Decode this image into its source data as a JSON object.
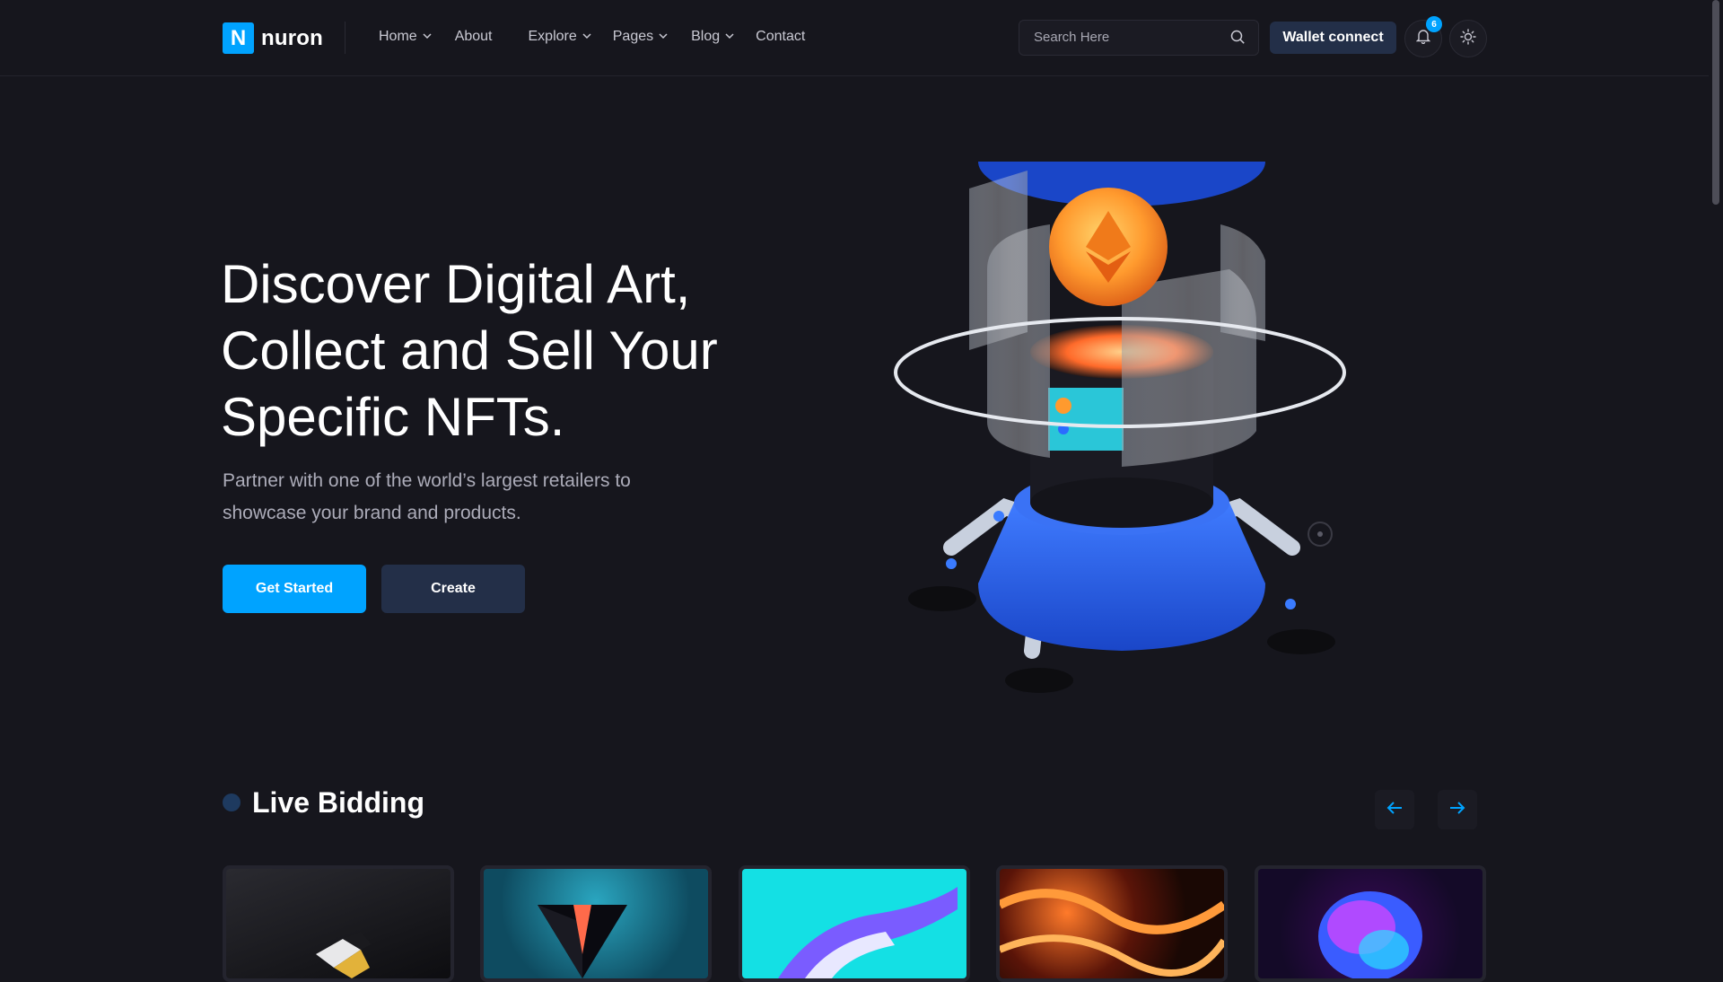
{
  "brand": {
    "logo_letter": "N",
    "name": "nuron",
    "accent": "#00a3ff"
  },
  "nav": {
    "items": [
      {
        "label": "Home",
        "has_dropdown": true
      },
      {
        "label": "About",
        "has_dropdown": false
      },
      {
        "label": "Explore",
        "has_dropdown": true
      },
      {
        "label": "Pages",
        "has_dropdown": true
      },
      {
        "label": "Blog",
        "has_dropdown": true
      },
      {
        "label": "Contact",
        "has_dropdown": false
      }
    ]
  },
  "search": {
    "placeholder": "Search Here",
    "icon": "search-icon"
  },
  "header_actions": {
    "wallet_label": "Wallet connect",
    "notification_count": "6",
    "bell_icon": "bell-icon",
    "theme_icon": "sun-icon"
  },
  "hero": {
    "title_lines": [
      "Discover Digital Art,",
      "Collect and Sell Your",
      "Specific NFTs."
    ],
    "subtitle": "Partner with one of the world’s largest retailers to showcase your brand and products.",
    "primary_button": "Get Started",
    "secondary_button": "Create"
  },
  "live_bidding": {
    "title": "Live Bidding",
    "prev_icon": "arrow-left-icon",
    "next_icon": "arrow-right-icon",
    "cards": [
      {
        "name": "nft-card-1",
        "theme": "dark-gold"
      },
      {
        "name": "nft-card-2",
        "theme": "teal-prism"
      },
      {
        "name": "nft-card-3",
        "theme": "cyan-hand"
      },
      {
        "name": "nft-card-4",
        "theme": "lava-abstract"
      },
      {
        "name": "nft-card-5",
        "theme": "neon-bust"
      }
    ]
  },
  "colors": {
    "background": "#16161d",
    "secondary_button": "#232f48",
    "muted_text": "#acacb9"
  }
}
